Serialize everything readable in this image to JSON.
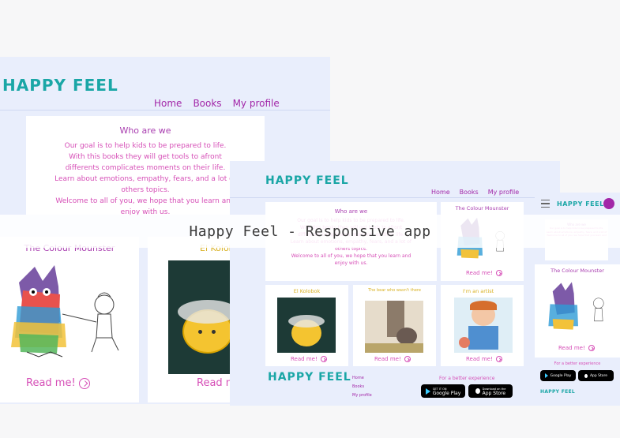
{
  "overlay_title": "Happy Feel - Responsive app",
  "brand": "HAPPY FEEL",
  "nav": {
    "home": "Home",
    "books": "Books",
    "profile": "My profile"
  },
  "who": {
    "heading": "Who are we",
    "lines": [
      "Our goal is to help kids to be prepared to life.",
      "With this books they will get tools to afront",
      "differents complicates moments on their life.",
      "Learn about emotions, empathy, fears, and a lot of",
      "others topics.",
      "Welcome to all of you, we hope that you learn and",
      "enjoy with us."
    ]
  },
  "books": {
    "monster": "The Colour Mounster",
    "kolbok": "El Kolobok",
    "bear": "The bear who wasn't there",
    "artist": "I'm an artist"
  },
  "read_more": "Read me!",
  "footer": {
    "links": [
      "Home",
      "Books",
      "My profile"
    ],
    "experience": "For a better experience",
    "google_small": "GET IT ON",
    "google_big": "Google Play",
    "apple_small": "Download on the",
    "apple_big": "App Store"
  },
  "colors": {
    "teal": "#1aa6a6",
    "purple": "#a227a8",
    "pink": "#d64fb7",
    "bg": "#e9eefc"
  }
}
